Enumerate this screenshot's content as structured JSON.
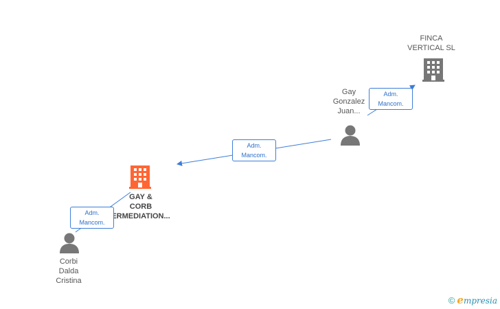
{
  "nodes": {
    "finca": {
      "lines": [
        "FINCA",
        "VERTICAL  SL"
      ],
      "icon": "building-icon",
      "color": "#777777"
    },
    "gay_gonzalez": {
      "lines": [
        "Gay",
        "Gonzalez",
        "Juan..."
      ],
      "icon": "person-icon",
      "color": "#777777"
    },
    "gay_corb": {
      "lines": [
        "GAY &",
        "CORB",
        "ERMEDIATION..."
      ],
      "icon": "building-icon",
      "color": "#ff6633"
    },
    "corbi": {
      "lines": [
        "Corbi",
        "Dalda",
        "Cristina"
      ],
      "icon": "person-icon",
      "color": "#777777"
    }
  },
  "edges": {
    "e1": {
      "lines": [
        "Adm.",
        "Mancom."
      ]
    },
    "e2": {
      "lines": [
        "Adm.",
        "Mancom."
      ]
    },
    "e3": {
      "lines": [
        "Adm.",
        "Mancom."
      ]
    }
  },
  "colors": {
    "edge": "#3b7dd8",
    "edge_label_text": "#2f6fc9"
  },
  "footer": {
    "copyright": "©",
    "brand_e": "e",
    "brand_rest": "mpresia"
  }
}
